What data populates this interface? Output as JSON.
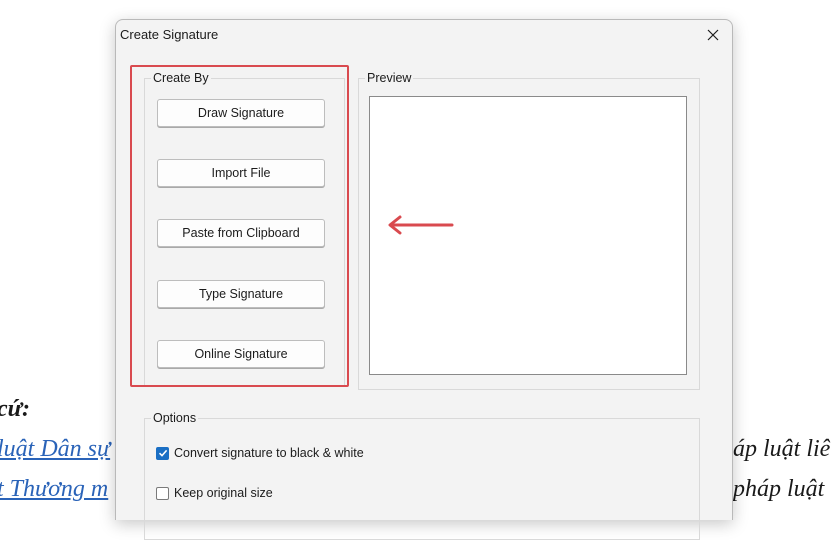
{
  "document": {
    "heading": "cứ:",
    "link1": "luật Dân sự",
    "link2": "t Thương m",
    "right1": "áp luật liê",
    "right2": "pháp luật"
  },
  "dialog": {
    "title": "Create Signature",
    "close_icon": "close-icon",
    "create_by": {
      "label": "Create By",
      "buttons": [
        "Draw Signature",
        "Import File",
        "Paste from Clipboard",
        "Type Signature",
        "Online Signature"
      ]
    },
    "preview": {
      "label": "Preview"
    },
    "options": {
      "label": "Options",
      "convert_bw": {
        "label": "Convert signature to black & white",
        "checked": true
      },
      "keep_size": {
        "label": "Keep original size",
        "checked": false
      }
    }
  },
  "annotation": {
    "highlight_color": "#d94a4f",
    "arrow_icon": "left-arrow-icon"
  },
  "colors": {
    "dialog_bg": "#f3f3f3",
    "checkbox_accent": "#1a6fc4",
    "link": "#2a63b8"
  }
}
